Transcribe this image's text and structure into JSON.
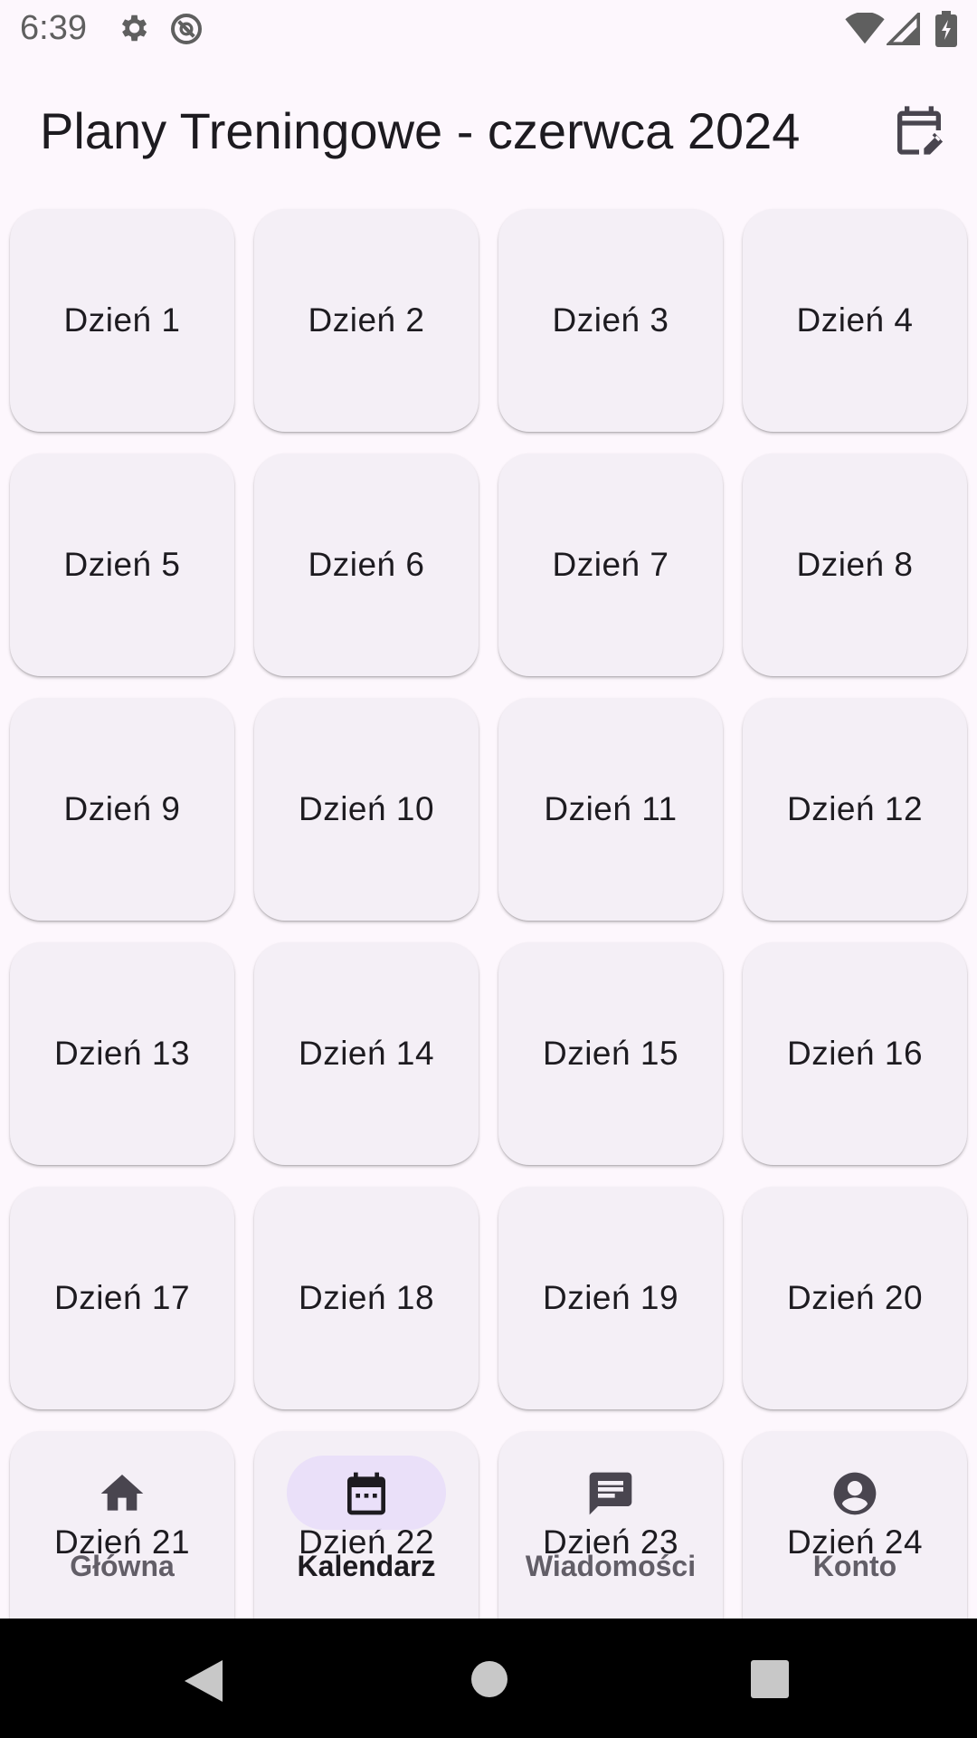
{
  "status_bar": {
    "time": "6:39",
    "icons": [
      "settings-icon",
      "no-disturb-icon",
      "wifi-icon",
      "signal-icon",
      "battery-icon"
    ]
  },
  "app_bar": {
    "title": "Plany Treningowe - czerwca 2024",
    "action_icon": "edit-calendar-icon"
  },
  "days": [
    "Dzień 1",
    "Dzień 2",
    "Dzień 3",
    "Dzień 4",
    "Dzień 5",
    "Dzień 6",
    "Dzień 7",
    "Dzień 8",
    "Dzień 9",
    "Dzień 10",
    "Dzień 11",
    "Dzień 12",
    "Dzień 13",
    "Dzień 14",
    "Dzień 15",
    "Dzień 16",
    "Dzień 17",
    "Dzień 18",
    "Dzień 19",
    "Dzień 20",
    "Dzień 21",
    "Dzień 22",
    "Dzień 23",
    "Dzień 24"
  ],
  "bottom_nav": {
    "items": [
      {
        "label": "Główna",
        "icon": "home-icon",
        "active": false
      },
      {
        "label": "Kalendarz",
        "icon": "calendar-icon",
        "active": true
      },
      {
        "label": "Wiadomości",
        "icon": "chat-icon",
        "active": false
      },
      {
        "label": "Konto",
        "icon": "account-icon",
        "active": false
      }
    ]
  },
  "colors": {
    "background": "#fdf7fd",
    "card": "#f4eff6",
    "active_pill": "#e8def8",
    "text": "#1d1b20"
  }
}
